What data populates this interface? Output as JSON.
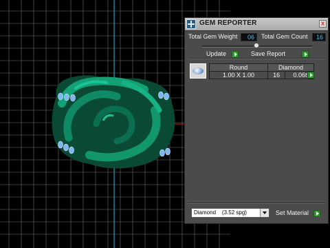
{
  "panel": {
    "title": "GEM REPORTER",
    "close_glyph": "x",
    "total_weight_label": "Total Gem Weight",
    "total_weight_value": "06",
    "total_count_label": "Total Gem Count",
    "total_count_value": "16",
    "update_label": "Update",
    "save_report_label": "Save Report",
    "table": {
      "headers": [
        "Round",
        "Diamond"
      ],
      "row": {
        "size": "1.00 X 1.00",
        "count": "16",
        "weight": "0.06tw"
      }
    },
    "material_select": {
      "selected": "Diamond    (3.52 spg)"
    },
    "set_material_label": "Set Material"
  },
  "colors": {
    "model_green": "#0e7d5a",
    "gem_blue": "#7fb6f2",
    "axis_cyan": "#1ec3e8",
    "axis_red": "#e02020",
    "grid": "#6f6f6f"
  },
  "icons": {
    "app": "gem-reporter-app-icon",
    "close": "close-icon",
    "play": "play-arrow-icon",
    "dropdown": "chevron-down-icon"
  }
}
